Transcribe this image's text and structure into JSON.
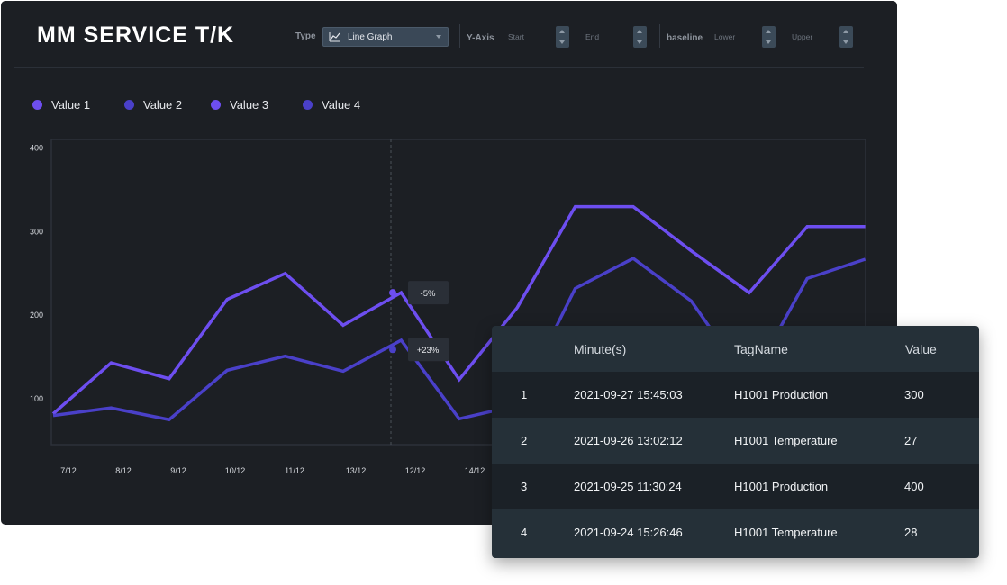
{
  "title": "MM SERVICE T/K",
  "toolbar": {
    "type_label": "Type",
    "type_value": "Line Graph",
    "yaxis_label": "Y-Axis",
    "start_placeholder": "Start",
    "end_placeholder": "End",
    "baseline_label": "baseline",
    "lower_placeholder": "Lower",
    "upper_placeholder": "Upper"
  },
  "colors": {
    "series_bright": "#6d4ef0",
    "series_mid": "#4a40c9",
    "panel_bg": "#1c1f24"
  },
  "chart_data": {
    "type": "line",
    "categories": [
      "7/12",
      "8/12",
      "9/12",
      "10/12",
      "11/12",
      "13/12",
      "12/12",
      "14/12"
    ],
    "ylim": [
      50,
      400
    ],
    "yticks": [
      100,
      200,
      300,
      400
    ],
    "legend": [
      "Value 1",
      "Value 2",
      "Value 3",
      "Value 4"
    ],
    "series": [
      {
        "name": "Value 1",
        "color": "#6d4ef0",
        "points": [
          [
            0,
            82
          ],
          [
            1,
            143
          ],
          [
            2,
            124
          ],
          [
            3,
            219
          ],
          [
            4,
            250
          ],
          [
            5,
            188
          ],
          [
            6,
            227
          ],
          [
            7,
            123
          ],
          [
            8,
            209
          ],
          [
            9,
            330
          ],
          [
            10,
            330
          ],
          [
            11,
            277
          ],
          [
            12,
            227
          ],
          [
            13,
            306
          ],
          [
            14,
            306
          ]
        ]
      },
      {
        "name": "Value 2",
        "color": "#4a40c9",
        "points": [
          [
            0,
            80
          ],
          [
            1,
            89
          ],
          [
            2,
            75
          ],
          [
            3,
            134
          ],
          [
            4,
            151
          ],
          [
            5,
            133
          ],
          [
            6,
            170
          ],
          [
            7,
            76
          ],
          [
            8,
            92
          ],
          [
            9,
            232
          ],
          [
            10,
            268
          ],
          [
            11,
            217
          ],
          [
            12,
            118
          ],
          [
            13,
            244
          ],
          [
            14,
            267
          ]
        ]
      }
    ],
    "marker": {
      "x": 6,
      "annotations": [
        {
          "label": "-5%",
          "y": 227
        },
        {
          "label": "+23%",
          "y": 159
        }
      ]
    }
  },
  "table": {
    "headers": [
      "Minute(s)",
      "TagName",
      "Value"
    ],
    "rows": [
      {
        "index": "1",
        "time": "2021-09-27 15:45:03",
        "tag": "H1001 Production",
        "value": "300"
      },
      {
        "index": "2",
        "time": "2021-09-26 13:02:12",
        "tag": "H1001 Temperature",
        "value": "27"
      },
      {
        "index": "3",
        "time": "2021-09-25 11:30:24",
        "tag": "H1001 Production",
        "value": "400"
      },
      {
        "index": "4",
        "time": "2021-09-24 15:26:46",
        "tag": "H1001 Temperature",
        "value": "28"
      }
    ]
  }
}
